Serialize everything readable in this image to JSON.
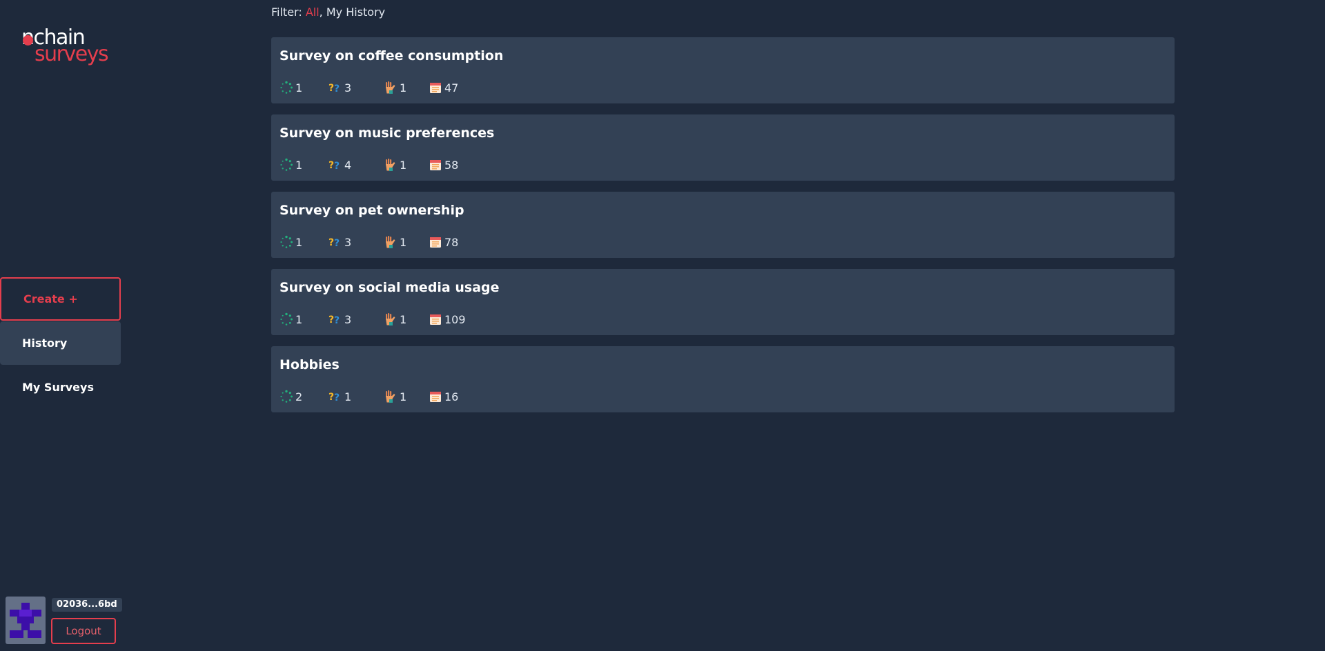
{
  "app": {
    "logo_top": "nchain",
    "logo_bottom": "surveys"
  },
  "sidebar": {
    "create_label": "Create +",
    "history_label": "History",
    "my_surveys_label": "My Surveys"
  },
  "user": {
    "address": "02036...6bd",
    "logout_label": "Logout"
  },
  "filter": {
    "label": "Filter:",
    "active": "All",
    "separator": ",",
    "option": "My History"
  },
  "colors": {
    "accent": "#e53e4d",
    "background": "#1e293b",
    "card": "#334155"
  },
  "icons": {
    "stat_1": "spinner-icon",
    "stat_2": "question-marks-icon",
    "stat_3": "raised-hand-icon",
    "stat_4": "calendar-icon"
  },
  "surveys": [
    {
      "title": "Survey on coffee consumption",
      "stat_1": "1",
      "stat_2": "3",
      "stat_3": "1",
      "stat_4": "47"
    },
    {
      "title": "Survey on music preferences",
      "stat_1": "1",
      "stat_2": "4",
      "stat_3": "1",
      "stat_4": "58"
    },
    {
      "title": "Survey on pet ownership",
      "stat_1": "1",
      "stat_2": "3",
      "stat_3": "1",
      "stat_4": "78"
    },
    {
      "title": "Survey on social media usage",
      "stat_1": "1",
      "stat_2": "3",
      "stat_3": "1",
      "stat_4": "109"
    },
    {
      "title": "Hobbies",
      "stat_1": "2",
      "stat_2": "1",
      "stat_3": "1",
      "stat_4": "16"
    }
  ]
}
